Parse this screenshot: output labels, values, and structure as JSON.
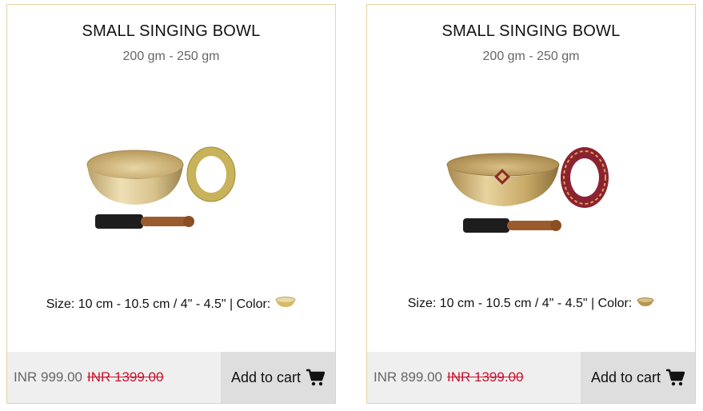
{
  "products": [
    {
      "title": "SMALL SINGING BOWL",
      "weight": "200 gm - 250 gm",
      "spec_text": "Size: 10 cm - 10.5 cm / 4\" - 4.5\" | Color:",
      "price_now": "INR 999.00",
      "price_old": "INR 1399.00",
      "cart_label": "Add to cart",
      "color_swatch": "#d7b968",
      "ring_color": "#c8b25a",
      "mallet": "wooden mallet with black felt",
      "icon": "cart-icon"
    },
    {
      "title": "SMALL SINGING BOWL",
      "weight": "200 gm - 250 gm",
      "spec_text": "Size: 10 cm - 10.5 cm / 4\" - 4.5\" | Color:",
      "price_now": "INR 899.00",
      "price_old": "INR 1399.00",
      "cart_label": "Add to cart",
      "color_swatch": "#b8954e",
      "ring_color": "#8b2232",
      "mallet": "wooden mallet with black felt",
      "icon": "cart-icon"
    }
  ],
  "colors": {
    "card_border": "#e6d3a0",
    "price_old": "#c8102e",
    "footer_bg": "#efefef",
    "cart_bg": "#dedede"
  }
}
